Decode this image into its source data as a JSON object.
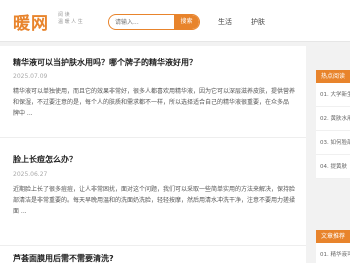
{
  "header": {
    "logo": "暖网",
    "slogan_line1": "阅 读",
    "slogan_line2": "温 暖 人 生",
    "search": {
      "placeholder": "请输入...",
      "value": "请输入...",
      "button": "搜索"
    },
    "nav": [
      "生活",
      "护肤"
    ]
  },
  "articles": [
    {
      "title": "精华液可以当护肤水用吗？哪个牌子的精华液好用？",
      "date": "2025.07.09",
      "lines": [
        "精华液可以单独使用，而且它的效果非常好，很多人都喜欢用精华液，因为它可以深层滋养皮肤，提供营养",
        "和保湿，不过要注意的是，每个人的肤质和需求都不一样，所以选择适合自己的精华液很重要，在众多品",
        "牌中 ..."
      ]
    },
    {
      "title": "脸上长痘怎么办？",
      "date": "2025.06.27",
      "lines": [
        "近期脸上长了很多痘痘，让人非常困扰，面对这个问题，我们可以采取一些简单实用的方法来解决，保持脸",
        "部清洁是非常重要的。每天早晚用温和的洗面奶洗脸，轻轻按摩，然后用清水冲洗干净，注意不要用力搓揉",
        "面 ..."
      ]
    },
    {
      "title": "芦荟面膜用后需不需要清洗?"
    }
  ],
  "sidebar": {
    "hot_title": "热点阅读",
    "hot_items": [
      "01. 大学新生",
      "02. 黄肤水用",
      "03. 如何脸部",
      "04. 提黄肤"
    ],
    "rec_title": "文章推荐",
    "rec_items": [
      "01. 精华液可"
    ]
  }
}
